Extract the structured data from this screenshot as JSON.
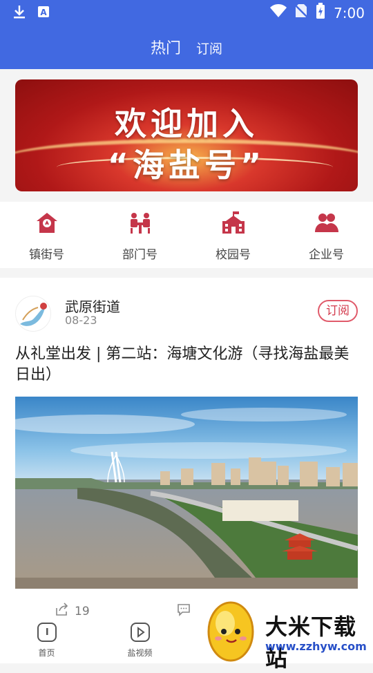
{
  "status_bar": {
    "time": "7:00"
  },
  "nav": {
    "tabs": [
      {
        "label": "热门",
        "active": true
      },
      {
        "label": "订阅",
        "active": false
      }
    ]
  },
  "banner": {
    "line1": "欢迎加入",
    "line2": "“海盐号”"
  },
  "categories": [
    {
      "label": "镇街号",
      "icon": "house-icon"
    },
    {
      "label": "部门号",
      "icon": "meeting-icon"
    },
    {
      "label": "校园号",
      "icon": "school-icon"
    },
    {
      "label": "企业号",
      "icon": "people-icon"
    }
  ],
  "article": {
    "source_name": "武原街道",
    "date": "08-23",
    "subscribe_label": "订阅",
    "title": "从礼堂出发 | 第二站：海塘文化游（寻找海盐最美日出）",
    "share_count": "19"
  },
  "tabbar": [
    {
      "label": "首页",
      "icon": "home-icon"
    },
    {
      "label": "盐视频",
      "icon": "video-icon"
    }
  ],
  "watermark": {
    "title": "大米下载站",
    "url": "www.zzhyw.com"
  },
  "colors": {
    "accent": "#4169e1",
    "brand_red": "#c5364a"
  }
}
